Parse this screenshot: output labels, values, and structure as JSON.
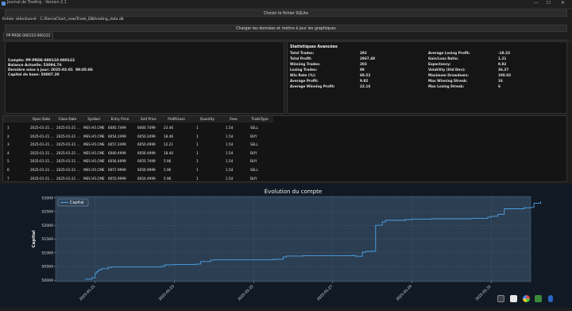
{
  "window": {
    "title": "Journal de Trading - Version 2.1",
    "minimize": "—",
    "maximize": "☐",
    "close": "✕"
  },
  "toolbar": {
    "choose_file_label": "Choisir le fichier SQLite",
    "selected_file_label": "Fichier sélectionné : C:/SierraChart_new/Trade_DB/trading_data.db",
    "load_label": "Charger les données et mettre à jour les graphiques"
  },
  "tabs": [
    {
      "label": "PP-PRDE-000110-000122"
    }
  ],
  "account": {
    "compte": "Compte: PP-PRDE-000110-000122",
    "balance": "Balance Actuelle: 53094.76",
    "last_update": "Dernière mise à jour: 2025-02-01  09:05:06",
    "base_capital": "Capital de base: 50007.20"
  },
  "stats": {
    "title": "Statistiques Avancées",
    "left": [
      {
        "label": "Total Trades:",
        "value": "292"
      },
      {
        "label": "Total Profit:",
        "value": "2867.48"
      },
      {
        "label": "Winning Trades:",
        "value": "203"
      },
      {
        "label": "Losing Trades:",
        "value": "89"
      },
      {
        "label": "Win Rate (%):",
        "value": "69.52"
      },
      {
        "label": "Average Profit:",
        "value": "9.82"
      },
      {
        "label": "Average Winning Profit:",
        "value": "22.16"
      }
    ],
    "right": [
      {
        "label": "Average Losing Profit:",
        "value": "-18.33"
      },
      {
        "label": "Gain/Loss Ratio:",
        "value": "1.21"
      },
      {
        "label": "Expectancy:",
        "value": "9.82"
      },
      {
        "label": "Volatility (Std Dev):",
        "value": "36.37"
      },
      {
        "label": "Maximum Drawdown:",
        "value": "190.02"
      },
      {
        "label": "Max Winning Streak:",
        "value": "16"
      },
      {
        "label": "Max Losing Streak:",
        "value": "6"
      }
    ]
  },
  "table": {
    "columns": [
      "Open Date",
      "Close Date",
      "Symbol",
      "Entry Price",
      "Exit Price",
      "Profit/Loss",
      "Quantity",
      "Fees",
      "TradeType"
    ],
    "rows": [
      {
        "n": "1",
        "cells": [
          "2025-01-21 ...",
          "2025-01-21 ...",
          "MES H5.CME",
          "6085.7499",
          "6060.7499",
          "23.46",
          "1",
          "1.54",
          "SELL"
        ]
      },
      {
        "n": "2",
        "cells": [
          "2025-01-21 ...",
          "2025-01-21 ...",
          "MES H5.CME",
          "6054.2499",
          "6050.2499",
          "18.46",
          "1",
          "1.54",
          "BUY"
        ]
      },
      {
        "n": "3",
        "cells": [
          "2025-01-21 ...",
          "2025-01-21 ...",
          "MES H5.CME",
          "6057.2499",
          "6050.4999",
          "12.21",
          "1",
          "1.54",
          "SELL"
        ]
      },
      {
        "n": "4",
        "cells": [
          "2025-01-21 ...",
          "2025-01-21 ...",
          "MES H5.CME",
          "6060.4999",
          "6056.4999",
          "18.46",
          "1",
          "1.54",
          "BUY"
        ]
      },
      {
        "n": "5",
        "cells": [
          "2025-01-21 ...",
          "2025-01-21 ...",
          "MES H5.CME",
          "6056.4999",
          "6055.7499",
          "5.96",
          "1",
          "1.54",
          "BUY"
        ]
      },
      {
        "n": "6",
        "cells": [
          "2025-01-21 ...",
          "2025-01-21 ...",
          "MES H5.CME",
          "6057.9999",
          "6056.9999",
          "5.96",
          "1",
          "1.54",
          "SELL"
        ]
      },
      {
        "n": "7",
        "cells": [
          "2025-01-21 ...",
          "2025-01-21 ...",
          "MES H5.CME",
          "6055.9999",
          "6054.4999",
          "5.96",
          "1",
          "1.54",
          "BUY"
        ]
      },
      {
        "n": "8",
        "cells": [
          "2025-01-21 ...",
          "2025-01-21 ...",
          "MES H5.CME",
          "6054.4999",
          "6053.9999",
          "5.96",
          "1",
          "1.54",
          "SELL"
        ]
      },
      {
        "n": "9",
        "cells": [
          "2025-01-21 ...",
          "2025-01-21 ...",
          "MES H5.CME",
          "6056.7499",
          "6056.9999",
          "-10.29",
          "1",
          "1.54",
          "BUY"
        ]
      }
    ]
  },
  "chart_data": {
    "type": "line",
    "title": "Évolution du compte",
    "xlabel": "",
    "ylabel": "Capital",
    "legend": "top-left",
    "grid": true,
    "ylim": [
      49950,
      53050
    ],
    "xlim": [
      "2025-01-20",
      "2025-02-01"
    ],
    "y_ticks": [
      50000,
      50500,
      51000,
      51500,
      52000,
      52500,
      53000
    ],
    "y_tick_labels": [
      "50000",
      "50500",
      "51000",
      "51500",
      "52000",
      "52500",
      "53000"
    ],
    "x_ticks": [
      "2025-01-21",
      "2025-01-23",
      "2025-01-25",
      "2025-01-27",
      "2025-01-29",
      "2025-01-31"
    ],
    "color": "#4da3e6",
    "series": [
      {
        "name": "Capital",
        "x": [
          "2025-01-20T18:00",
          "2025-01-20T22:00",
          "2025-01-21T00:00",
          "2025-01-21T01:00",
          "2025-01-21T02:00",
          "2025-01-21T04:00",
          "2025-01-21T08:00",
          "2025-01-21T10:00",
          "2025-01-22T16:00",
          "2025-01-22T18:00",
          "2025-01-23T00:00",
          "2025-01-23T12:00",
          "2025-01-23T14:00",
          "2025-01-23T16:00",
          "2025-01-23T22:00",
          "2025-01-24T00:00",
          "2025-01-25T12:00",
          "2025-01-25T18:00",
          "2025-01-25T20:00",
          "2025-01-26T06:00",
          "2025-01-27T12:00",
          "2025-01-27T14:00",
          "2025-01-27T18:00",
          "2025-01-27T20:00",
          "2025-01-28T00:00",
          "2025-01-28T02:00",
          "2025-01-28T06:00",
          "2025-01-28T08:00",
          "2025-01-28T20:00",
          "2025-01-29T00:00",
          "2025-01-29T12:00",
          "2025-01-30T12:00",
          "2025-01-30T22:00",
          "2025-01-31T00:00",
          "2025-01-31T04:00",
          "2025-01-31T08:00",
          "2025-01-31T20:00",
          "2025-02-01T00:00",
          "2025-02-01T02:00",
          "2025-02-01T06:00"
        ],
        "y": [
          50040,
          50090,
          50260,
          50310,
          50380,
          50420,
          50470,
          50480,
          50500,
          50560,
          50570,
          50580,
          50590,
          50680,
          50730,
          50740,
          50760,
          50850,
          50880,
          50890,
          50900,
          50870,
          51020,
          51050,
          51060,
          52000,
          52120,
          52180,
          52210,
          52220,
          52240,
          52250,
          52300,
          52330,
          52400,
          52600,
          52640,
          52650,
          52800,
          52860
        ]
      }
    ]
  }
}
